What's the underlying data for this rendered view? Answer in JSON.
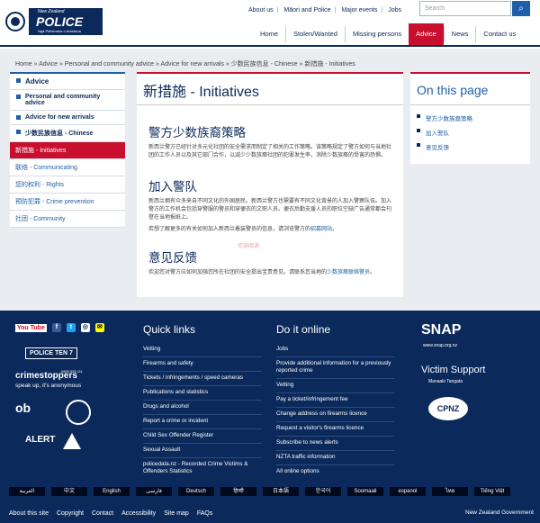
{
  "header": {
    "logo": {
      "line1": "New Zealand",
      "line2": "POLICE",
      "line3": "Ngā Pirihimana o Aotearoa"
    },
    "util_links": [
      "About us",
      "Māori and Police",
      "Major events",
      "Jobs"
    ],
    "search_placeholder": "Search",
    "nav": [
      "Home",
      "Stolen/Wanted",
      "Missing persons",
      "Advice",
      "News",
      "Contact us"
    ]
  },
  "breadcrumb": "Home » Advice » Personal and community advice » Advice for new arrivals » 少数民族信息 - Chinese » 新措施 - Initiatives",
  "sidebar": {
    "items": [
      "Advice",
      "Personal and community advice",
      "Advice for new arrivals",
      "少数民族信息 - Chinese"
    ],
    "current": "新措施 - Initiatives",
    "children": [
      "联络 - Communicating",
      "您的权利 - Rights",
      "预防犯罪 - Crime prevention",
      "社团 - Community"
    ]
  },
  "main": {
    "title": "新措施 - Initiatives",
    "s1_h": "警方少数族裔策略",
    "s1_p": "新西兰警方已经针对多元化社团的安全需求而制定了相关的工作策略。该策略规定了警方如何与当地社团的工作人员以及其它部门合作，以减少少数族裔社团的犯罪发生率，消除少数族裔的受害的恐惧。",
    "s2_h": "加入警队",
    "s2_p1": "新西兰拥有众多来自不同文化的外国居民。新西兰警方也需要有不同文化背景的人加入警察队伍。加入警方的工作机会包括穿警服的警员和穿便衣的文职人员。便衣后勤支援人员的职位空缺广告通常都会刊登在当地报纸上。",
    "s2_p2a": "若想了解更多的有关如何加入新西兰着装警员的信息，请浏览警方的",
    "s2_p2link": "招募网站",
    "s2_p2b": "。",
    "watermark": "欢迎阅读",
    "s3_h": "意见反馈",
    "s3_pa": "欢迎您对警方应如何加强您所在社团的安全提出宝贵意见。请联系您当地的",
    "s3_plink": "少数族裔联络警员",
    "s3_pb": "。"
  },
  "on_this_page": {
    "title": "On this page",
    "links": [
      "警方少数族裔策略",
      "加入警队",
      "意见反馈"
    ]
  },
  "footer": {
    "social": {
      "youtube": "You Tube",
      "facebook": "f",
      "twitter": "t",
      "instagram": "◎",
      "snapchat": "✉"
    },
    "police_ten_7": "POLICE TEN 7",
    "crimestoppers": "crimestoppers",
    "crimestoppers_num": "0800 555 111",
    "crimestoppers_tag": "speak up, it's anonymous",
    "ob": "ob",
    "alert": "ALERT",
    "quick_title": "Quick links",
    "quick": [
      "Vetting",
      "Firearms and safety",
      "Tickets / infringements / speed cameras",
      "Publications and statistics",
      "Drugs and alcohol",
      "Report a crime or incident",
      "Child Sex Offender Register",
      "Sexual Assault",
      "policedata.nz - Recorded Crime Victims & Offenders Statistics"
    ],
    "doit_title": "Do it online",
    "doit": [
      "Jobs",
      "Provide additional information for a previously reported crime",
      "Vetting",
      "Pay a ticket/infringement fee",
      "Change address on firearms licence",
      "Request a visitor's firearms licence",
      "Subscribe to news alerts",
      "NZTA traffic information",
      "All online options"
    ],
    "snap": "SNAP",
    "snap_url": "www.snap.org.nz",
    "victim": "Victim Support",
    "victim_t": "Manaaki Tangata",
    "cpnz": "CPNZ",
    "langs": [
      "العربية",
      "中文",
      "English",
      "فارسی",
      "Deutsch",
      "हिन्दी",
      "日本語",
      "한국어",
      "Soomaali",
      "espanol",
      "ไทย",
      "Tiếng Việt"
    ],
    "bottom": [
      "About this site",
      "Copyright",
      "Contact",
      "Accessibility",
      "Site map",
      "FAQs"
    ],
    "govt": "New Zealand Government"
  }
}
